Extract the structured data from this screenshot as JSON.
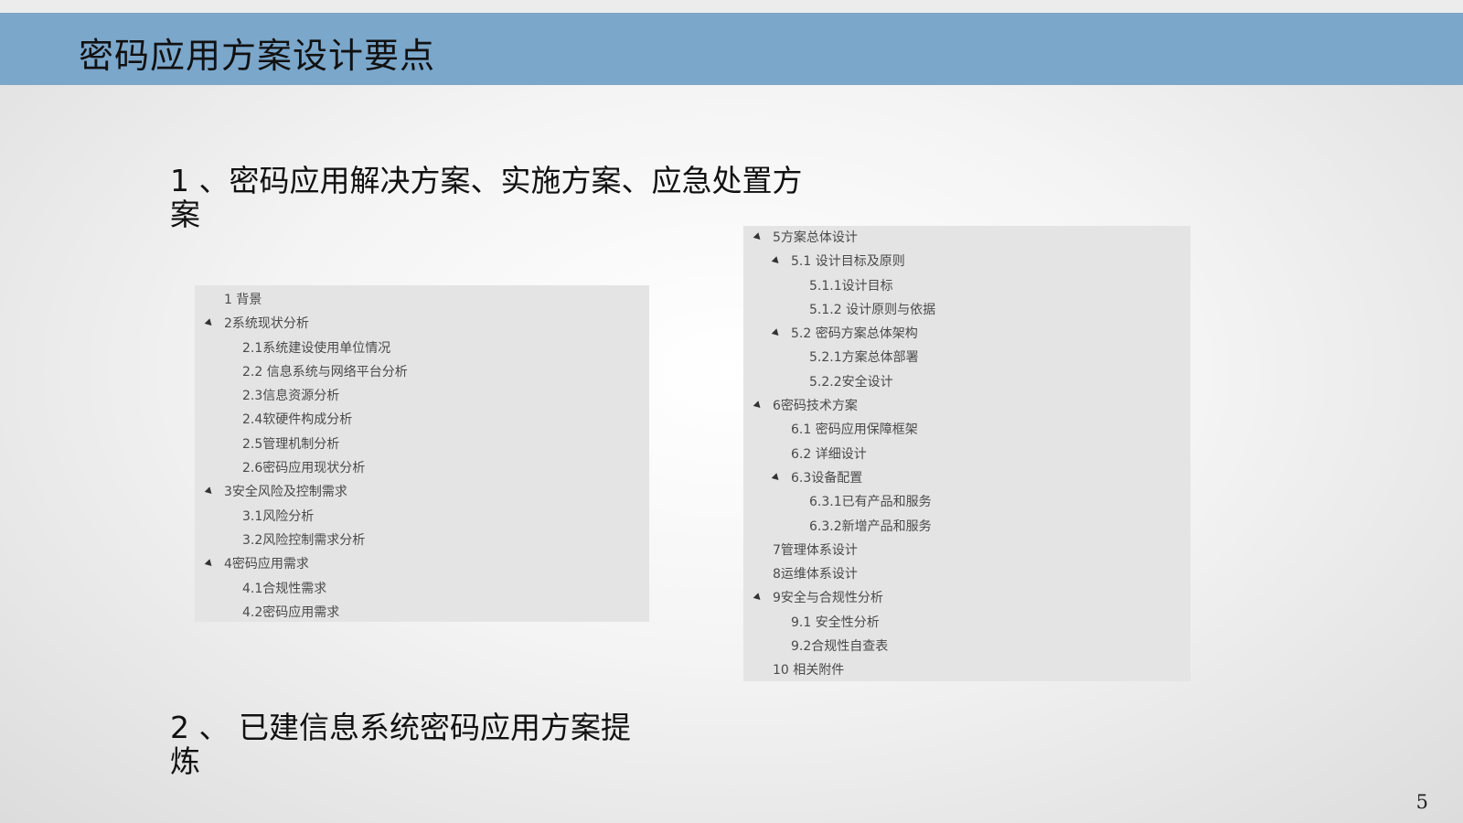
{
  "slide": {
    "title": "密码应用方案设计要点",
    "page_number": "5"
  },
  "points": [
    {
      "text": "1 、密码应用解决方案、实施方案、应急处置方案"
    },
    {
      "text": "2 、  已建信息系统密码应用方案提炼"
    }
  ],
  "toc_left": [
    {
      "label": "1 背景",
      "level": 1,
      "expanded": false
    },
    {
      "label": "2系统现状分析",
      "level": 1,
      "expanded": true
    },
    {
      "label": "2.1系统建设使用单位情况",
      "level": 2,
      "expanded": false
    },
    {
      "label": "2.2 信息系统与网络平台分析",
      "level": 2,
      "expanded": false
    },
    {
      "label": "2.3信息资源分析",
      "level": 2,
      "expanded": false
    },
    {
      "label": "2.4软硬件构成分析",
      "level": 2,
      "expanded": false
    },
    {
      "label": "2.5管理机制分析",
      "level": 2,
      "expanded": false
    },
    {
      "label": "2.6密码应用现状分析",
      "level": 2,
      "expanded": false
    },
    {
      "label": "3安全风险及控制需求",
      "level": 1,
      "expanded": true
    },
    {
      "label": "3.1风险分析",
      "level": 2,
      "expanded": false
    },
    {
      "label": "3.2风险控制需求分析",
      "level": 2,
      "expanded": false
    },
    {
      "label": "4密码应用需求",
      "level": 1,
      "expanded": true
    },
    {
      "label": "4.1合规性需求",
      "level": 2,
      "expanded": false
    },
    {
      "label": "4.2密码应用需求",
      "level": 2,
      "expanded": false
    }
  ],
  "toc_right": [
    {
      "label": "5方案总体设计",
      "level": 1,
      "expanded": true
    },
    {
      "label": "5.1 设计目标及原则",
      "level": 2,
      "expanded": true
    },
    {
      "label": "5.1.1设计目标",
      "level": 3,
      "expanded": false
    },
    {
      "label": "5.1.2 设计原则与依据",
      "level": 3,
      "expanded": false
    },
    {
      "label": "5.2 密码方案总体架构",
      "level": 2,
      "expanded": true
    },
    {
      "label": "5.2.1方案总体部署",
      "level": 3,
      "expanded": false
    },
    {
      "label": "5.2.2安全设计",
      "level": 3,
      "expanded": false
    },
    {
      "label": "6密码技术方案",
      "level": 1,
      "expanded": true
    },
    {
      "label": "6.1 密码应用保障框架",
      "level": 2,
      "expanded": false
    },
    {
      "label": "6.2 详细设计",
      "level": 2,
      "expanded": false
    },
    {
      "label": "6.3设备配置",
      "level": 2,
      "expanded": true
    },
    {
      "label": "6.3.1已有产品和服务",
      "level": 3,
      "expanded": false
    },
    {
      "label": "6.3.2新增产品和服务",
      "level": 3,
      "expanded": false
    },
    {
      "label": "7管理体系设计",
      "level": 1,
      "expanded": false
    },
    {
      "label": "8运维体系设计",
      "level": 1,
      "expanded": false
    },
    {
      "label": "9安全与合规性分析",
      "level": 1,
      "expanded": true
    },
    {
      "label": "9.1 安全性分析",
      "level": 2,
      "expanded": false
    },
    {
      "label": "9.2合规性自查表",
      "level": 2,
      "expanded": false
    },
    {
      "label": "10 相关附件",
      "level": 1,
      "expanded": false
    }
  ],
  "colors": {
    "title_bar": "#7ba7cb",
    "toc_panel": "#e4e4e4"
  }
}
